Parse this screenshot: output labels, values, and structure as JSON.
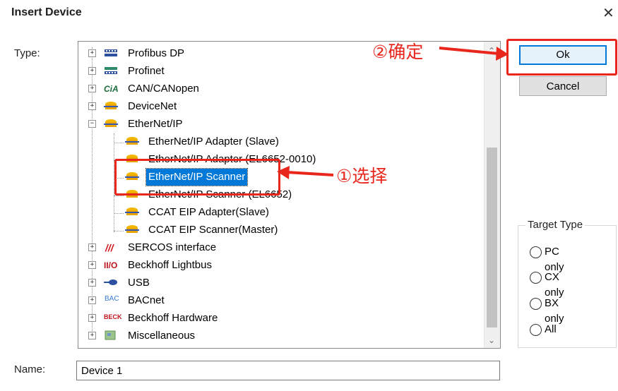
{
  "window": {
    "title": "Insert Device"
  },
  "labels": {
    "type": "Type:",
    "name": "Name:"
  },
  "tree": {
    "items": [
      {
        "label": "Profibus DP",
        "icon": "profibus-icon",
        "expander": "+"
      },
      {
        "label": "Profinet",
        "icon": "profinet-icon",
        "expander": "+"
      },
      {
        "label": "CAN/CANopen",
        "icon": "cia-icon",
        "icon_text": "CiA",
        "expander": "+"
      },
      {
        "label": "DeviceNet",
        "icon": "device-icon",
        "expander": "+"
      },
      {
        "label": "EtherNet/IP",
        "icon": "device-icon",
        "expander": "−"
      },
      {
        "label": "EtherNet/IP Adapter (Slave)",
        "icon": "device-icon"
      },
      {
        "label": "EtherNet/IP Adapter (EL6652-0010)",
        "icon": "device-icon"
      },
      {
        "label": "EtherNet/IP Scanner",
        "icon": "device-icon",
        "selected": true
      },
      {
        "label": "EtherNet/IP Scanner (EL6652)",
        "icon": "device-icon"
      },
      {
        "label": "CCAT EIP Adapter(Slave)",
        "icon": "device-icon"
      },
      {
        "label": "CCAT EIP Scanner(Master)",
        "icon": "device-icon"
      },
      {
        "label": "SERCOS interface",
        "icon": "sercos-icon",
        "icon_text": "///",
        "expander": "+"
      },
      {
        "label": "Beckhoff Lightbus",
        "icon": "io-icon",
        "icon_text": "II/O",
        "expander": "+"
      },
      {
        "label": "USB",
        "icon": "usb-icon",
        "expander": "+"
      },
      {
        "label": "BACnet",
        "icon": "bacnet-icon",
        "icon_text": "BAC",
        "expander": "+"
      },
      {
        "label": "Beckhoff Hardware",
        "icon": "beckhoff-icon",
        "icon_text": "BECK",
        "expander": "+"
      },
      {
        "label": "Miscellaneous",
        "icon": "misc-icon",
        "expander": "+"
      }
    ]
  },
  "buttons": {
    "ok": "Ok",
    "cancel": "Cancel"
  },
  "target_type": {
    "legend": "Target Type",
    "options": [
      "PC only",
      "CX only",
      "BX only",
      "All"
    ]
  },
  "name_field": {
    "value": "Device 1"
  },
  "annotations": {
    "step1": "①选择",
    "step2": "②确定"
  },
  "colors": {
    "annotation_red": "#e8261c",
    "selection_blue": "#0078d7"
  }
}
